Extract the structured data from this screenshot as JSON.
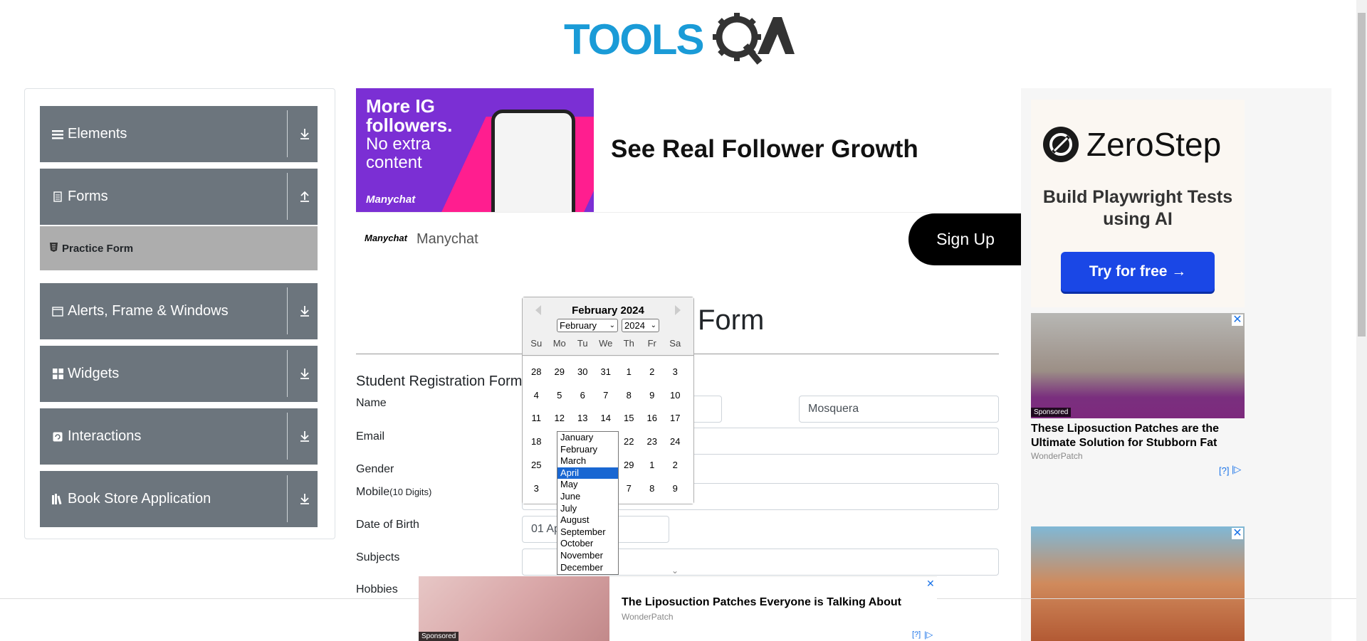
{
  "header": {
    "logo_text": "TOOLSQA"
  },
  "sidebar": {
    "groups": [
      {
        "label": "Elements",
        "icon": "menu-icon",
        "arrow": "down"
      },
      {
        "label": "Forms",
        "icon": "document-icon",
        "arrow": "up",
        "sub_items": [
          {
            "label": "Practice Form",
            "icon": "html-icon"
          }
        ]
      },
      {
        "label": "Alerts, Frame & Windows",
        "icon": "window-icon",
        "arrow": "down"
      },
      {
        "label": "Widgets",
        "icon": "widgets-icon",
        "arrow": "down"
      },
      {
        "label": "Interactions",
        "icon": "interactions-icon",
        "arrow": "down"
      },
      {
        "label": "Book Store Application",
        "icon": "books-icon",
        "arrow": "down"
      }
    ]
  },
  "ad_top": {
    "image_text_bold": "More IG followers.",
    "image_text": "No extra content",
    "image_brand": "Manychat",
    "headline": "See Real Follower Growth",
    "brand_logo": "Manychat",
    "brand": "Manychat",
    "cta": "Sign Up"
  },
  "ad_right": {
    "zerostep": {
      "name": "ZeroStep",
      "tagline": "Build Playwright Tests using AI",
      "cta": "Try for free →"
    },
    "lipo": {
      "sponsored": "Sponsored",
      "title": "These Liposuction Patches are the Ultimate Solution for Stubborn Fat",
      "source": "WonderPatch",
      "adchoice": "[?]"
    }
  },
  "ad_bottom": {
    "sponsored": "Sponsored",
    "title": "The Liposuction Patches Everyone is Talking About",
    "source": "WonderPatch",
    "adchoice": "[?]"
  },
  "form": {
    "page_title": "Form",
    "section_title": "Student Registration Form",
    "labels": {
      "name": "Name",
      "email": "Email",
      "gender": "Gender",
      "mobile": "Mobile",
      "mobile_hint": "(10 Digits)",
      "dob": "Date of Birth",
      "subjects": "Subjects",
      "hobbies": "Hobbies"
    },
    "last_name_value": "Mosquera",
    "dob_value": "01 Ap"
  },
  "calendar": {
    "title": "February 2024",
    "selected_month": "February",
    "selected_year": "2024",
    "weekdays": [
      "Su",
      "Mo",
      "Tu",
      "We",
      "Th",
      "Fr",
      "Sa"
    ],
    "weeks": [
      [
        "28",
        "29",
        "30",
        "31",
        "1",
        "2",
        "3"
      ],
      [
        "4",
        "5",
        "6",
        "7",
        "8",
        "9",
        "10"
      ],
      [
        "11",
        "12",
        "13",
        "14",
        "15",
        "16",
        "17"
      ],
      [
        "18",
        "",
        "",
        "",
        "22",
        "23",
        "24"
      ],
      [
        "25",
        "",
        "",
        "",
        "29",
        "1",
        "2"
      ],
      [
        "3",
        "",
        "",
        "",
        "7",
        "8",
        "9"
      ]
    ],
    "month_options": [
      "January",
      "February",
      "March",
      "April",
      "May",
      "June",
      "July",
      "August",
      "September",
      "October",
      "November",
      "December"
    ],
    "highlighted_month": "April"
  }
}
